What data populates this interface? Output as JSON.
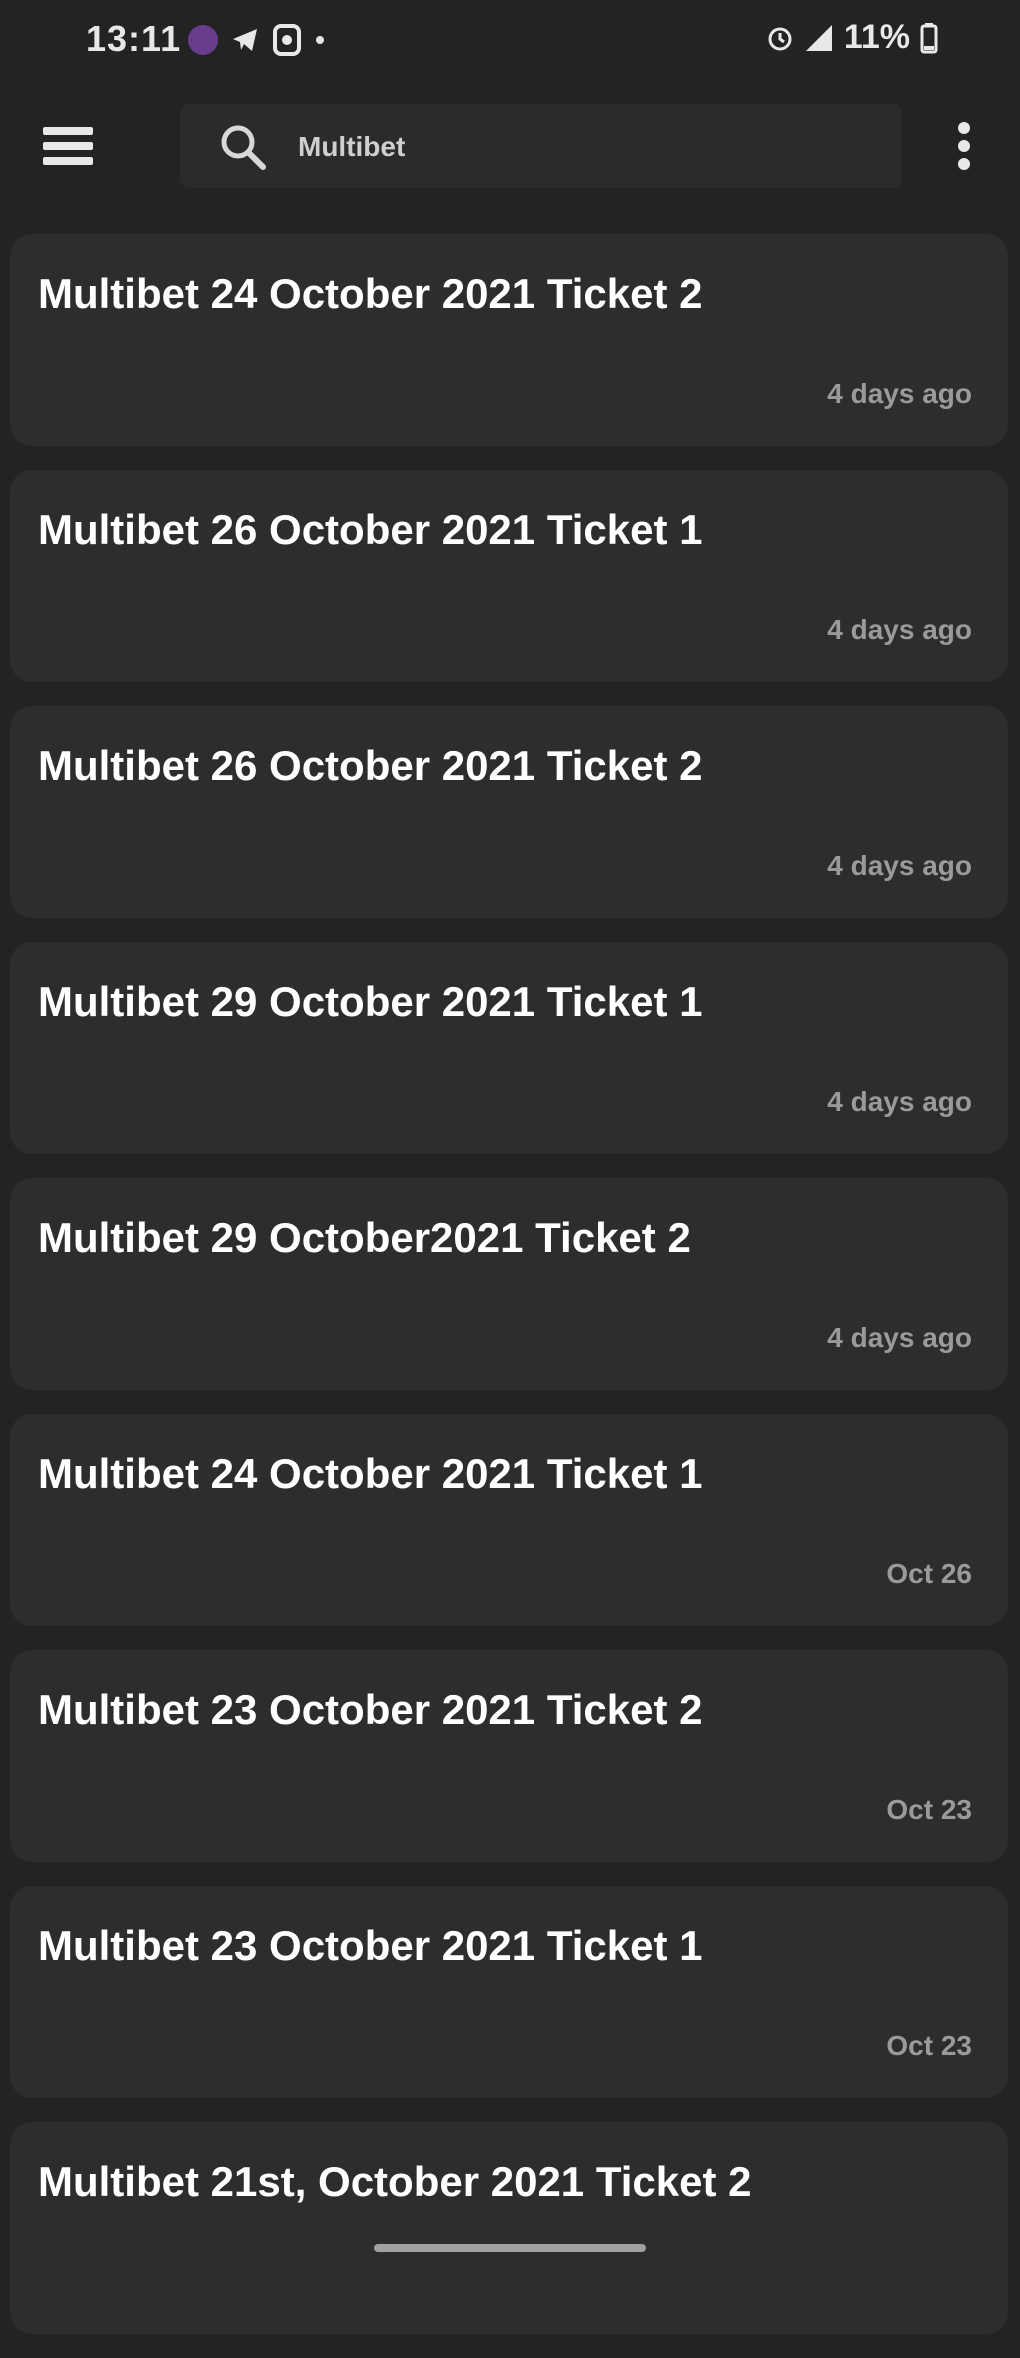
{
  "status_bar": {
    "time": "13:11",
    "battery": "11%"
  },
  "search": {
    "query": "Multibet"
  },
  "notes": [
    {
      "title": "Multibet 24 October 2021 Ticket 2",
      "time": "4 days ago"
    },
    {
      "title": "Multibet 26 October 2021 Ticket 1",
      "time": "4 days ago"
    },
    {
      "title": "Multibet 26 October 2021 Ticket 2",
      "time": "4 days ago"
    },
    {
      "title": "Multibet 29 October 2021 Ticket 1",
      "time": "4 days ago"
    },
    {
      "title": "Multibet 29 October2021 Ticket 2",
      "time": "4 days ago"
    },
    {
      "title": "Multibet 24 October 2021 Ticket 1",
      "time": "Oct 26"
    },
    {
      "title": "Multibet 23 October 2021 Ticket 2",
      "time": "Oct 23"
    },
    {
      "title": "Multibet 23 October 2021 Ticket 1",
      "time": "Oct 23"
    },
    {
      "title": "Multibet 21st,  October 2021 Ticket 2",
      "time": ""
    }
  ],
  "icons": {
    "menu": "hamburger-icon",
    "search": "search-icon",
    "overflow": "more-vert-icon"
  },
  "colors": {
    "background": "#232323",
    "card": "#2d2d2d",
    "accent_dot": "#6a3d8c"
  }
}
